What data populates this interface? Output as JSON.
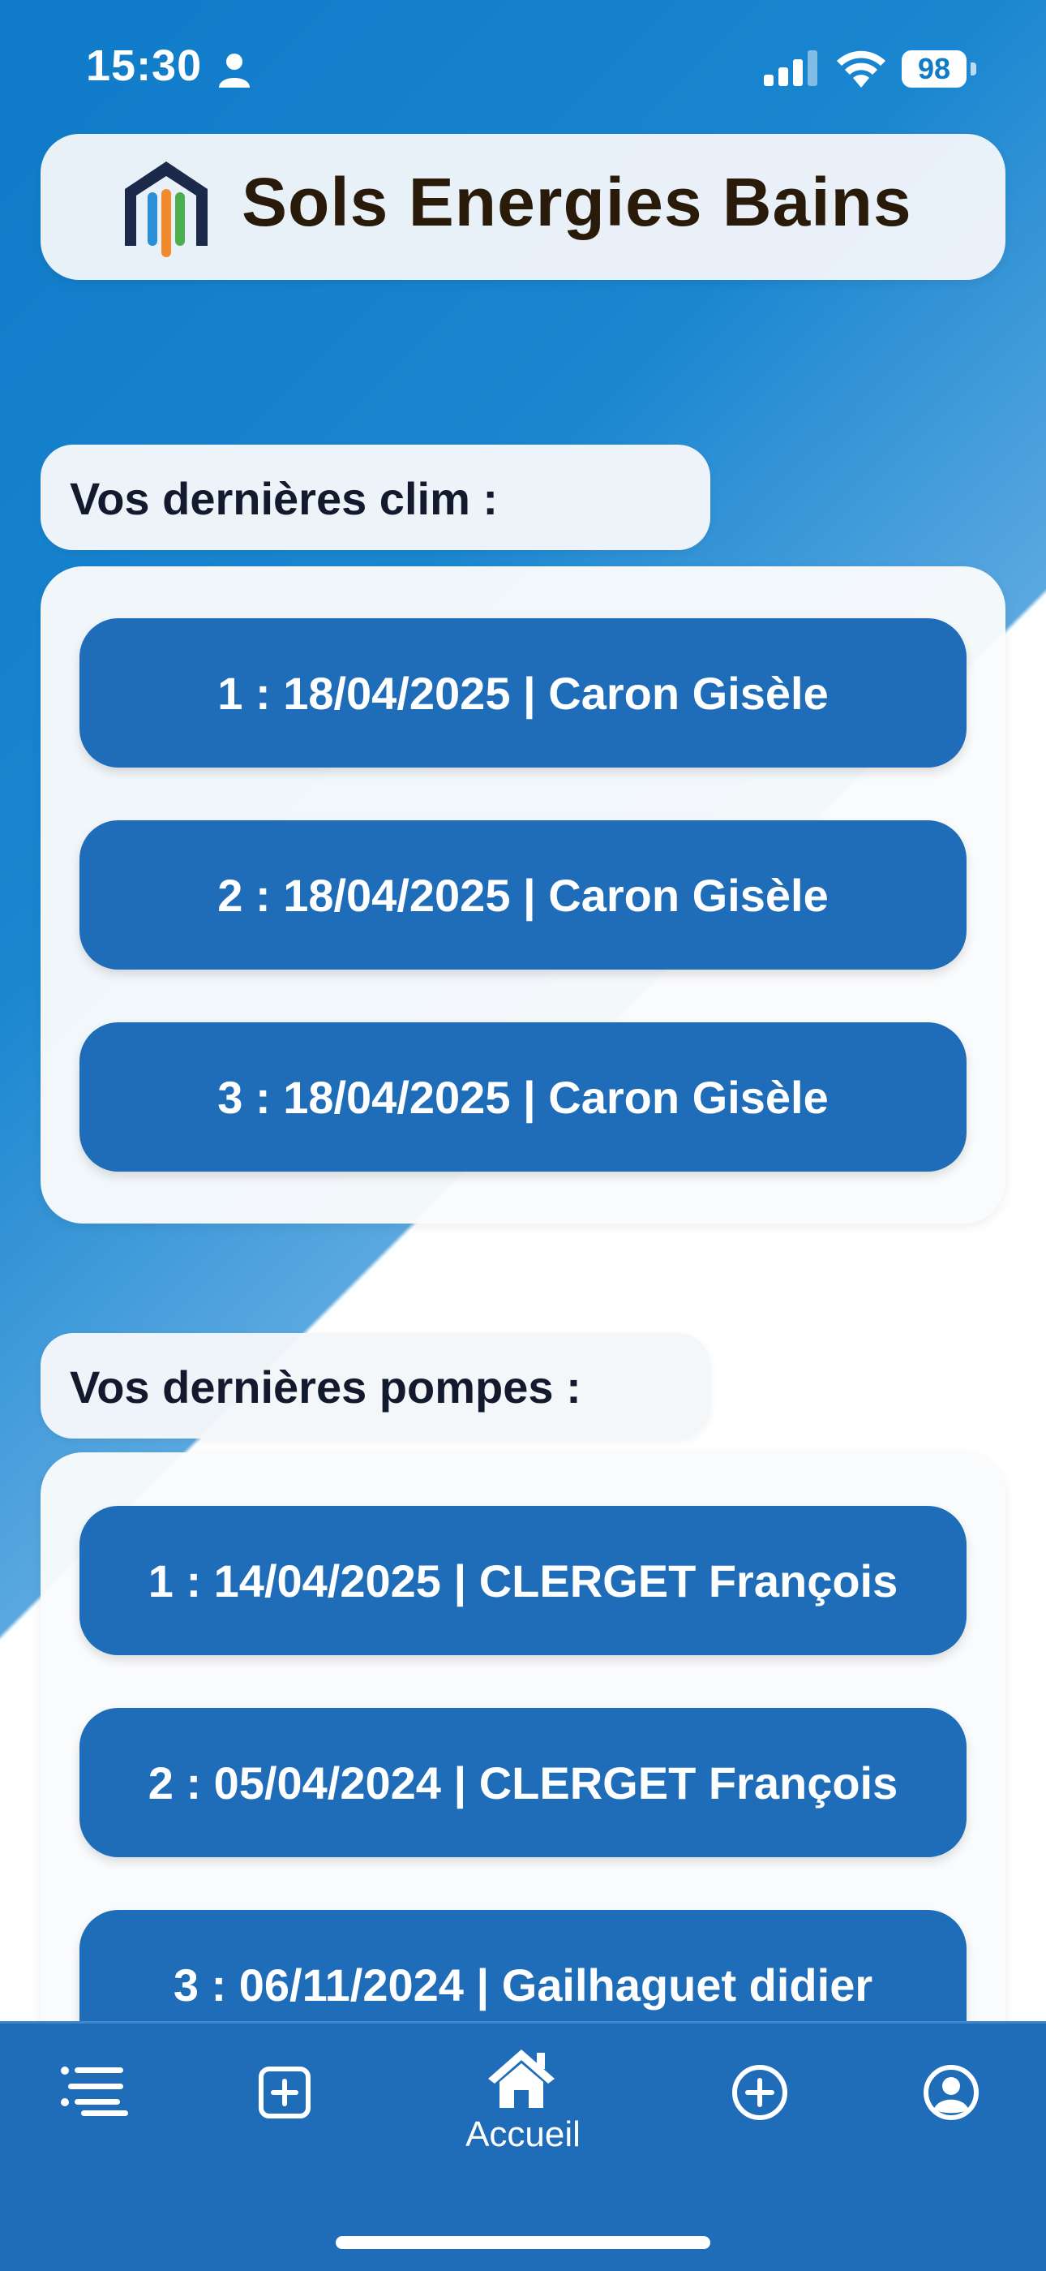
{
  "status_bar": {
    "time": "15:30",
    "battery": "98",
    "icons": [
      "person-icon",
      "cellular-signal-icon",
      "wifi-icon",
      "battery-icon"
    ]
  },
  "header": {
    "title": "Sols Energies Bains",
    "logo": "company-logo"
  },
  "sections": {
    "clim": {
      "label": "Vos dernières clim :",
      "items": [
        "1 : 18/04/2025 | Caron Gisèle",
        "2 : 18/04/2025 | Caron Gisèle",
        "3 : 18/04/2025 | Caron Gisèle"
      ]
    },
    "pompes": {
      "label": "Vos dernières pompes :",
      "items": [
        "1 : 14/04/2025 | CLERGET François",
        "2 : 05/04/2024 | CLERGET François",
        "3 : 06/11/2024 | Gailhaguet  didier"
      ]
    }
  },
  "nav": {
    "home_label": "Accueil",
    "items": [
      "list-icon",
      "add-square-icon",
      "home-icon",
      "add-circle-icon",
      "profile-icon"
    ]
  },
  "colors": {
    "primary": "#1f6db9",
    "gradient_top": "#0f7bc9",
    "title_text": "#2a1a0a"
  }
}
